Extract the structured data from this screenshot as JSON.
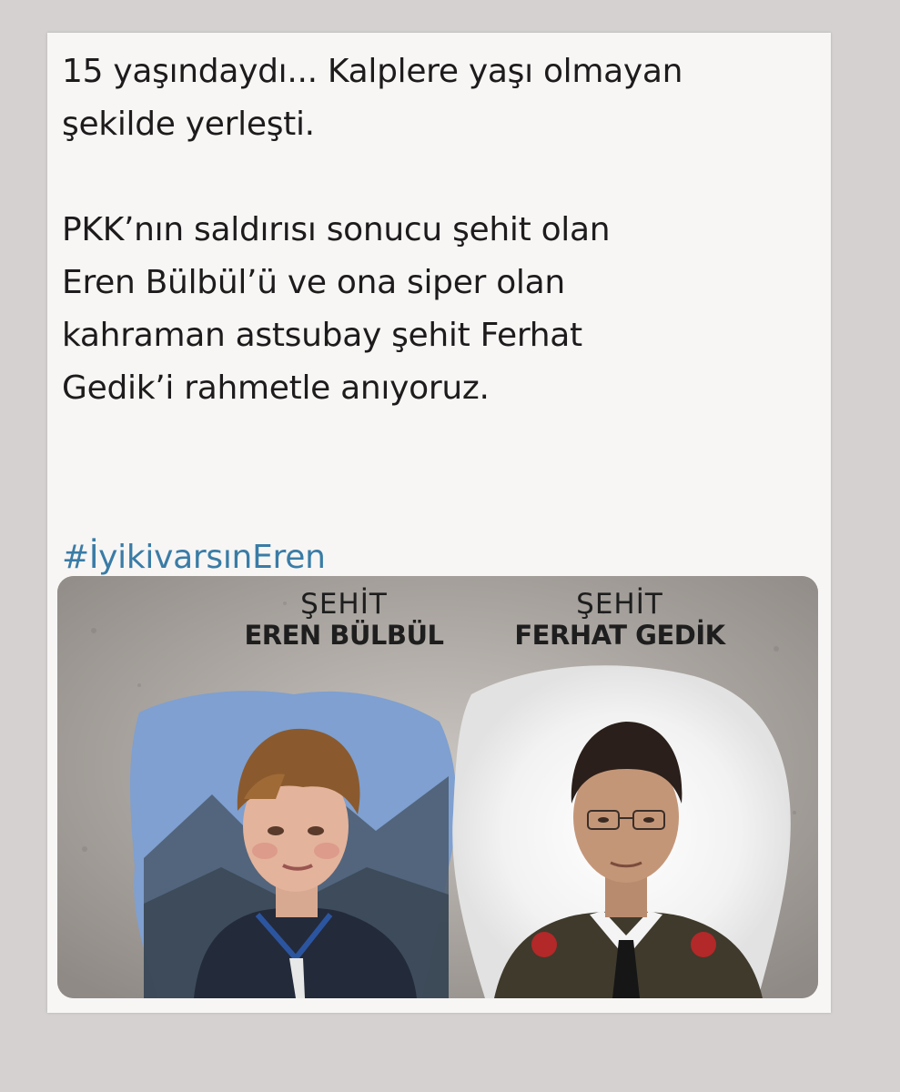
{
  "post": {
    "line1": "15 yaşındaydı... Kalplere yaşı olmayan",
    "line2": "şekilde yerleşti.",
    "line3": "PKK’nın saldırısı sonucu şehit olan",
    "line4": "Eren Bülbül’ü ve ona siper olan",
    "line5": "kahraman astsubay şehit Ferhat",
    "line6": "Gedik’i rahmetle anıyoruz.",
    "hashtag": "#İyikivarsınEren",
    "hashtag_color": "#3a7ca6"
  },
  "image": {
    "left_title": "ŞEHİT",
    "left_name": "EREN BÜLBÜL",
    "right_title": "ŞEHİT",
    "right_name": "FERHAT GEDİK"
  }
}
